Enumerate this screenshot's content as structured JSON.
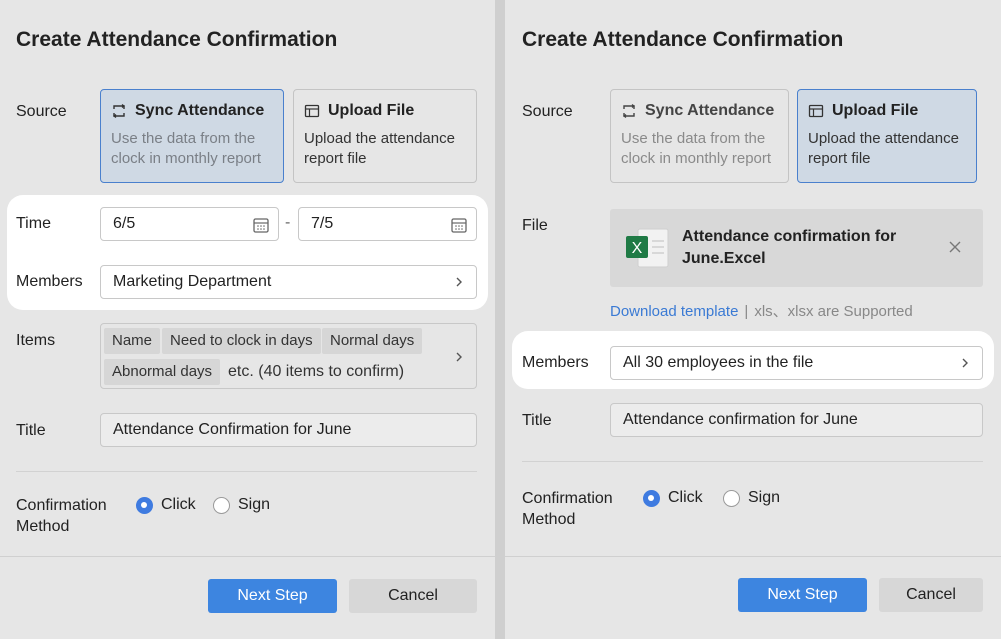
{
  "left": {
    "title": "Create Attendance Confirmation",
    "source_label": "Source",
    "sync_card": {
      "title": "Sync Attendance",
      "desc": "Use the data from the clock in monthly report"
    },
    "upload_card": {
      "title": "Upload File",
      "desc": "Upload the attendance report file"
    },
    "time_label": "Time",
    "time_start": "6/5",
    "time_sep": "-",
    "time_end": "7/5",
    "members_label": "Members",
    "members_value": "Marketing Department",
    "items_label": "Items",
    "items_tags": [
      "Name",
      "Need to clock in days",
      "Normal days",
      "Abnormal days"
    ],
    "items_more": "etc. (40 items to confirm)",
    "title_label": "Title",
    "title_value": "Attendance Confirmation for June",
    "method_label_1": "Confirmation",
    "method_label_2": "Method",
    "method_click": "Click",
    "method_sign": "Sign",
    "next_button": "Next Step",
    "cancel_button": "Cancel"
  },
  "right": {
    "title": "Create Attendance Confirmation",
    "source_label": "Source",
    "sync_card": {
      "title": "Sync Attendance",
      "desc": "Use the data from the clock in monthly report"
    },
    "upload_card": {
      "title": "Upload File",
      "desc": "Upload the attendance report file"
    },
    "file_label": "File",
    "file_name": "Attendance confirmation for June.Excel",
    "download_link": "Download template",
    "link_sep": "|",
    "supported": "xls、xlsx are Supported",
    "members_label": "Members",
    "members_value": "All 30 employees in the file",
    "title_label": "Title",
    "title_value": "Attendance confirmation for June",
    "method_label_1": "Confirmation",
    "method_label_2": "Method",
    "method_click": "Click",
    "method_sign": "Sign",
    "next_button": "Next Step",
    "cancel_button": "Cancel"
  },
  "colors": {
    "accent": "#3d85e0",
    "selected_bg": "#cfd9e4",
    "link": "#3a7ad4",
    "excel_green": "#1f7a45"
  }
}
